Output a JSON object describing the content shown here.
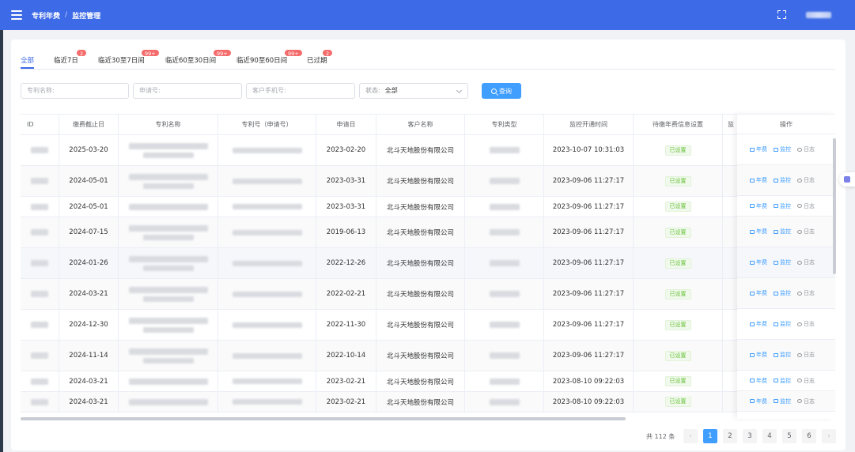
{
  "header": {
    "breadcrumb": [
      "专利年费",
      "监控管理"
    ],
    "separator": "/"
  },
  "tabs": [
    {
      "label": "全部",
      "badge": null,
      "active": true
    },
    {
      "label": "临近7日",
      "badge": "2"
    },
    {
      "label": "临近30至7日间",
      "badge": "99+"
    },
    {
      "label": "临近60至30日间",
      "badge": "99+"
    },
    {
      "label": "临近90至60日间",
      "badge": "99+"
    },
    {
      "label": "已过期",
      "badge": "2"
    }
  ],
  "filters": {
    "patent_name_placeholder": "专利名称:",
    "application_no_placeholder": "申请号:",
    "customer_phone_placeholder": "客户手机号:",
    "status_label": "状态:",
    "status_value": "全部",
    "query_label": "查询"
  },
  "table": {
    "columns": [
      "ID",
      "缴费截止日",
      "专利名称",
      "专利号（申请号）",
      "申请日",
      "客户名称",
      "专利类型",
      "监控开通时间",
      "待缴年费信息设置",
      "监"
    ],
    "ops_header": "操作",
    "rows": [
      {
        "deadline": "2025-03-20",
        "apply_date": "2023-02-20",
        "customer": "北斗天地股份有限公司",
        "monitor_time": "2023-10-07 10:31:03",
        "status": "已设置"
      },
      {
        "deadline": "2024-05-01",
        "apply_date": "2023-03-31",
        "customer": "北斗天地股份有限公司",
        "monitor_time": "2023-09-06 11:27:17",
        "status": "已设置"
      },
      {
        "deadline": "2024-05-01",
        "apply_date": "2023-03-31",
        "customer": "北斗天地股份有限公司",
        "monitor_time": "2023-09-06 11:27:17",
        "status": "已设置"
      },
      {
        "deadline": "2024-07-15",
        "apply_date": "2019-06-13",
        "customer": "北斗天地股份有限公司",
        "monitor_time": "2023-09-06 11:27:17",
        "status": "已设置"
      },
      {
        "deadline": "2024-01-26",
        "apply_date": "2022-12-26",
        "customer": "北斗天地股份有限公司",
        "monitor_time": "2023-09-06 11:27:17",
        "status": "已设置"
      },
      {
        "deadline": "2024-03-21",
        "apply_date": "2022-02-21",
        "customer": "北斗天地股份有限公司",
        "monitor_time": "2023-09-06 11:27:17",
        "status": "已设置"
      },
      {
        "deadline": "2024-12-30",
        "apply_date": "2022-11-30",
        "customer": "北斗天地股份有限公司",
        "monitor_time": "2023-09-06 11:27:17",
        "status": "已设置"
      },
      {
        "deadline": "2024-11-14",
        "apply_date": "2022-10-14",
        "customer": "北斗天地股份有限公司",
        "monitor_time": "2023-09-06 11:27:17",
        "status": "已设置"
      },
      {
        "deadline": "2024-03-21",
        "apply_date": "2023-02-21",
        "customer": "北斗天地股份有限公司",
        "monitor_time": "2023-08-10 09:22:03",
        "status": "已设置"
      },
      {
        "deadline": "2024-03-21",
        "apply_date": "2023-02-21",
        "customer": "北斗天地股份有限公司",
        "monitor_time": "2023-08-10 09:22:03",
        "status": "已设置"
      }
    ],
    "actions": {
      "fee": "年费",
      "monitor": "监控",
      "log": "日志"
    }
  },
  "pagination": {
    "total_text": "共 112 条",
    "pages": [
      "1",
      "2",
      "3",
      "4",
      "5",
      "6"
    ],
    "current": "1",
    "prev": "‹",
    "next": "›"
  }
}
